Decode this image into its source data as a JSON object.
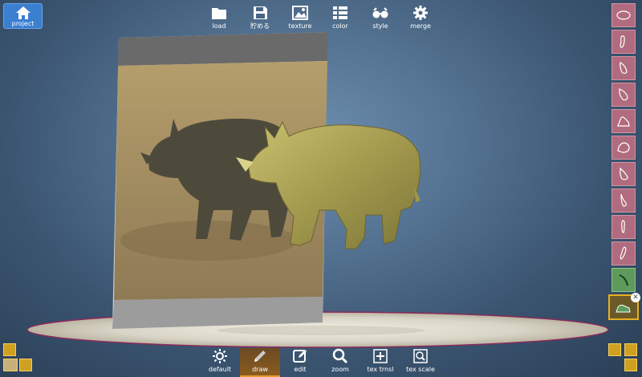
{
  "project": {
    "label": "project"
  },
  "toolbar_top": [
    {
      "id": "load",
      "label": "load",
      "icon": "folder-icon"
    },
    {
      "id": "save",
      "label": "貯める",
      "icon": "save-icon"
    },
    {
      "id": "texture",
      "label": "texture",
      "icon": "image-icon"
    },
    {
      "id": "color",
      "label": "color",
      "icon": "grid-icon"
    },
    {
      "id": "style",
      "label": "style",
      "icon": "glasses-icon"
    },
    {
      "id": "merge",
      "label": "merge",
      "icon": "gear-icon"
    }
  ],
  "toolbar_bottom": [
    {
      "id": "default",
      "label": "default",
      "icon": "sun-icon"
    },
    {
      "id": "draw",
      "label": "draw",
      "icon": "pencil-icon",
      "active": true
    },
    {
      "id": "edit",
      "label": "edit",
      "icon": "edit-icon"
    },
    {
      "id": "zoom",
      "label": "zoom",
      "icon": "magnifier-icon"
    },
    {
      "id": "tex-trnsl",
      "label": "tex trnsl",
      "icon": "plus-box-icon"
    },
    {
      "id": "tex-scale",
      "label": "tex scale",
      "icon": "search-box-icon"
    }
  ],
  "sidebar_shapes": [
    "oval-shape-icon",
    "bean-shape-icon",
    "leaf-shape-icon",
    "drop-shape-icon",
    "blob-shape-icon",
    "round-shape-icon",
    "teardrop-shape-icon",
    "hook-shape-icon",
    "sole-shape-icon",
    "tilted-shape-icon",
    "curve-shape-icon",
    "selected-shape-icon"
  ],
  "colors": {
    "accent": "#3a7fd0",
    "shape": "#b06c7e",
    "shape_active": "#5e9a5c",
    "selected_border": "#e8b020"
  }
}
